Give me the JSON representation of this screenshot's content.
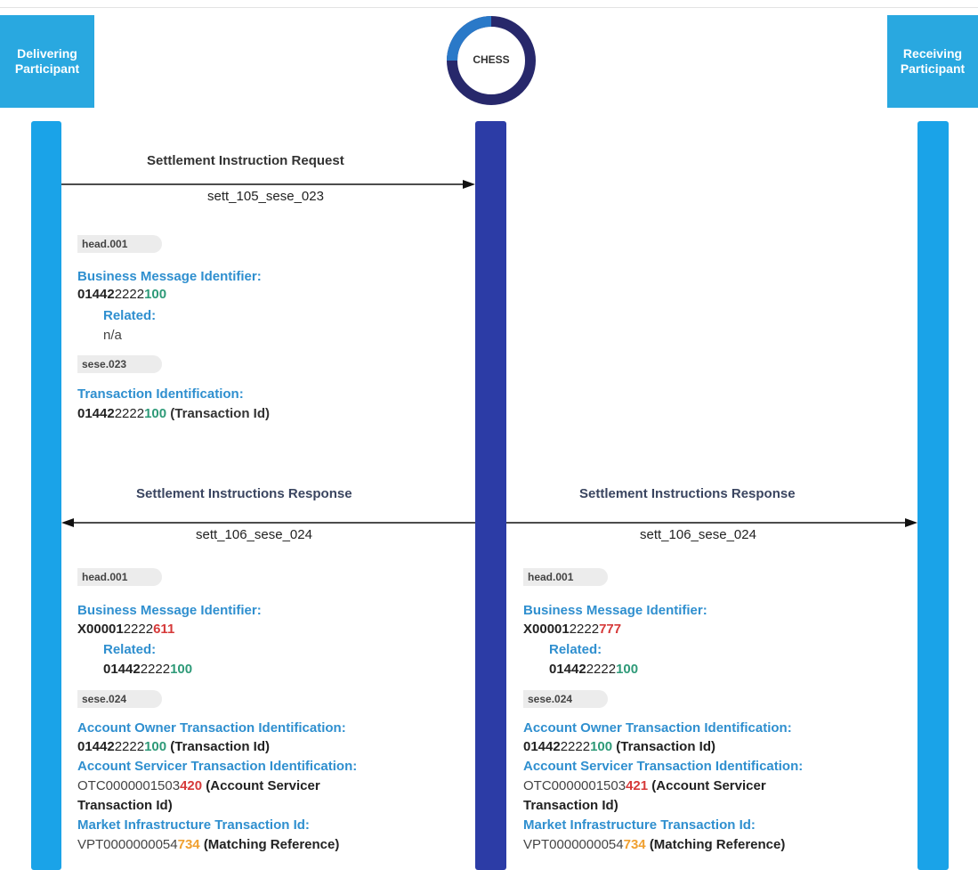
{
  "participants": {
    "delivering": {
      "line1": "Delivering",
      "line2": "Participant"
    },
    "chess": "CHESS",
    "receiving": {
      "line1": "Receiving",
      "line2": "Participant"
    }
  },
  "request": {
    "title": "Settlement Instruction Request",
    "code": "sett_105_sese_023",
    "head_tag": "head.001",
    "bmi_label": "Business Message Identifier:",
    "bmi_prefix": "01442",
    "bmi_mid": "2222",
    "bmi_suffix": "100",
    "related_label": "Related:",
    "related_value": "n/a",
    "body_tag": "sese.023",
    "tx_label": "Transaction Identification:",
    "tx_prefix": "01442",
    "tx_mid": "2222",
    "tx_suffix": "100",
    "tx_note": "(Transaction Id)"
  },
  "responses": [
    {
      "title": "Settlement Instructions Response",
      "code": "sett_106_sese_024",
      "head_tag": "head.001",
      "bmi_label": "Business Message Identifier:",
      "bmi_prefix": "X00001",
      "bmi_mid": "2222",
      "bmi_suffix": "611",
      "related_label": "Related:",
      "related_prefix": "01442",
      "related_mid": "2222",
      "related_suffix": "100",
      "body_tag": "sese.024",
      "aotx_label": "Account Owner Transaction Identification:",
      "aotx_prefix": "01442",
      "aotx_mid": "2222",
      "aotx_suffix": "100",
      "aotx_note": "(Transaction Id)",
      "astx_label": "Account Servicer Transaction Identification:",
      "astx_mid": "OTC0000001503",
      "astx_suffix": "420",
      "astx_note1": "(Account Servicer",
      "astx_note2": "Transaction Id)",
      "mitx_label": "Market Infrastructure Transaction Id:",
      "mitx_mid": "VPT0000000054",
      "mitx_suffix": "734",
      "mitx_note": "(Matching Reference)"
    },
    {
      "title": "Settlement Instructions Response",
      "code": "sett_106_sese_024",
      "head_tag": "head.001",
      "bmi_label": "Business Message Identifier:",
      "bmi_prefix": "X00001",
      "bmi_mid": "2222",
      "bmi_suffix": "777",
      "related_label": "Related:",
      "related_prefix": "01442",
      "related_mid": "2222",
      "related_suffix": "100",
      "body_tag": "sese.024",
      "aotx_label": "Account Owner Transaction Identification:",
      "aotx_prefix": "01442",
      "aotx_mid": "2222",
      "aotx_suffix": "100",
      "aotx_note": "(Transaction Id)",
      "astx_label": "Account Servicer Transaction Identification:",
      "astx_mid": "OTC0000001503",
      "astx_suffix": "421",
      "astx_note1": "(Account Servicer",
      "astx_note2": "Transaction Id)",
      "mitx_label": "Market Infrastructure Transaction Id:",
      "mitx_mid": "VPT0000000054",
      "mitx_suffix": "734",
      "mitx_note": "(Matching Reference)"
    }
  ],
  "colors": {
    "participant_box": "#29a8e0",
    "lifeline_blue": "#1aa3e8",
    "lifeline_chess": "#2c3ca6",
    "label_blue": "#2f8fcf",
    "id_green": "#2e9a78",
    "id_red": "#d63a3a",
    "id_orange": "#f0a030"
  }
}
